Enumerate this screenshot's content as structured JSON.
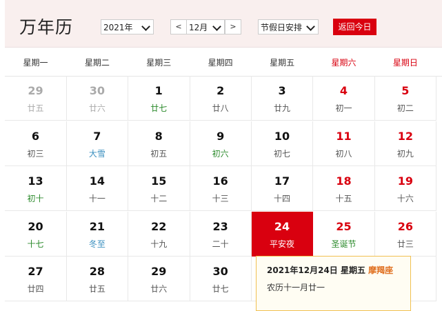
{
  "header": {
    "title": "万年历",
    "year_value": "2021年",
    "month_prev": "<",
    "month_value": "12月",
    "month_next": ">",
    "holiday_value": "节假日安排",
    "today_button": "返回今日"
  },
  "weekdays": [
    {
      "label": "星期一",
      "weekend": false
    },
    {
      "label": "星期二",
      "weekend": false
    },
    {
      "label": "星期三",
      "weekend": false
    },
    {
      "label": "星期四",
      "weekend": false
    },
    {
      "label": "星期五",
      "weekend": false
    },
    {
      "label": "星期六",
      "weekend": true
    },
    {
      "label": "星期日",
      "weekend": true
    }
  ],
  "days": [
    {
      "d": "29",
      "l": "廿五",
      "other": true
    },
    {
      "d": "30",
      "l": "廿六",
      "other": true
    },
    {
      "d": "1",
      "l": "廿七",
      "lt": "term"
    },
    {
      "d": "2",
      "l": "廿八"
    },
    {
      "d": "3",
      "l": "廿九"
    },
    {
      "d": "4",
      "l": "初一",
      "we": true
    },
    {
      "d": "5",
      "l": "初二",
      "we": true
    },
    {
      "d": "6",
      "l": "初三"
    },
    {
      "d": "7",
      "l": "大雪",
      "lt": "solar"
    },
    {
      "d": "8",
      "l": "初五"
    },
    {
      "d": "9",
      "l": "初六",
      "lt": "term"
    },
    {
      "d": "10",
      "l": "初七"
    },
    {
      "d": "11",
      "l": "初八",
      "we": true
    },
    {
      "d": "12",
      "l": "初九",
      "we": true
    },
    {
      "d": "13",
      "l": "初十",
      "lt": "term"
    },
    {
      "d": "14",
      "l": "十一"
    },
    {
      "d": "15",
      "l": "十二"
    },
    {
      "d": "16",
      "l": "十三"
    },
    {
      "d": "17",
      "l": "十四"
    },
    {
      "d": "18",
      "l": "十五",
      "we": true
    },
    {
      "d": "19",
      "l": "十六",
      "we": true
    },
    {
      "d": "20",
      "l": "十七",
      "lt": "term"
    },
    {
      "d": "21",
      "l": "冬至",
      "lt": "solar"
    },
    {
      "d": "22",
      "l": "十九"
    },
    {
      "d": "23",
      "l": "二十"
    },
    {
      "d": "24",
      "l": "平安夜",
      "selected": true
    },
    {
      "d": "25",
      "l": "圣诞节",
      "we": true,
      "lt": "term"
    },
    {
      "d": "26",
      "l": "廿三",
      "we": true
    },
    {
      "d": "27",
      "l": "廿四"
    },
    {
      "d": "28",
      "l": "廿五"
    },
    {
      "d": "29",
      "l": "廿六"
    },
    {
      "d": "30",
      "l": "廿七"
    },
    {
      "d": "",
      "l": ""
    },
    {
      "d": "",
      "l": ""
    },
    {
      "d": "",
      "l": ""
    }
  ],
  "popup": {
    "date_line": "2021年12月24日 星期五",
    "constellation": "摩羯座",
    "lunar_line": "农历十一月廿一"
  }
}
